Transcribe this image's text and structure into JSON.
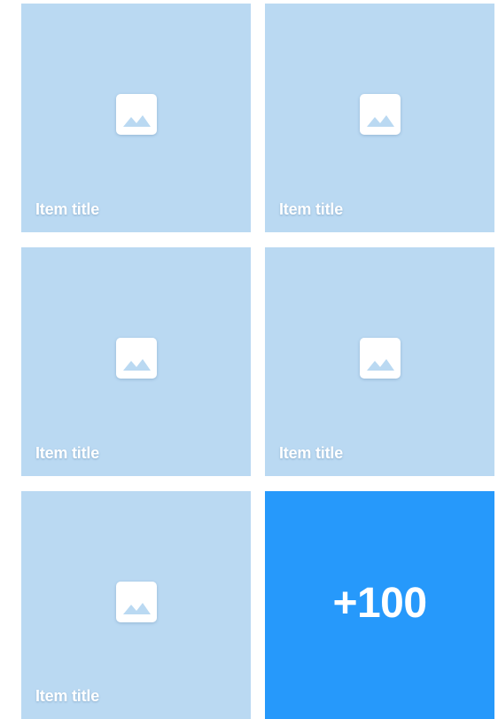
{
  "tiles": [
    {
      "title": "Item title",
      "icon": "image-placeholder-icon"
    },
    {
      "title": "Item title",
      "icon": "image-placeholder-icon"
    },
    {
      "title": "Item title",
      "icon": "image-placeholder-icon"
    },
    {
      "title": "Item title",
      "icon": "image-placeholder-icon"
    },
    {
      "title": "Item title",
      "icon": "image-placeholder-icon"
    }
  ],
  "more_tile": {
    "label": "+100"
  },
  "colors": {
    "tile_background": "#bad9f2",
    "more_background": "#2699fb",
    "text": "#ffffff"
  }
}
